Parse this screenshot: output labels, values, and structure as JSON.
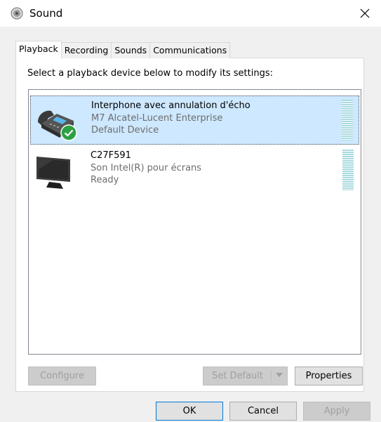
{
  "window": {
    "title": "Sound",
    "close_glyph": "✕"
  },
  "tabs": [
    {
      "label": "Playback",
      "active": true
    },
    {
      "label": "Recording",
      "active": false
    },
    {
      "label": "Sounds",
      "active": false
    },
    {
      "label": "Communications",
      "active": false
    }
  ],
  "playback": {
    "instruction": "Select a playback device below to modify its settings:",
    "devices": [
      {
        "name": "Interphone avec annulation d'écho",
        "description": "M7 Alcatel-Lucent Enterprise",
        "status": "Default Device",
        "icon": "desk-phone-icon",
        "selected": true,
        "default_badge": "check-badge-icon"
      },
      {
        "name": "C27F591",
        "description": "Son Intel(R) pour écrans",
        "status": "Ready",
        "icon": "monitor-icon",
        "selected": false
      }
    ]
  },
  "panel_buttons": {
    "configure": "Configure",
    "set_default": "Set Default",
    "properties": "Properties"
  },
  "dialog_buttons": {
    "ok": "OK",
    "cancel": "Cancel",
    "apply": "Apply"
  },
  "colors": {
    "selection": "#cde8ff",
    "level_meter": "#a9dadf",
    "check_badge": "#2ea043",
    "accent": "#0078d7"
  }
}
